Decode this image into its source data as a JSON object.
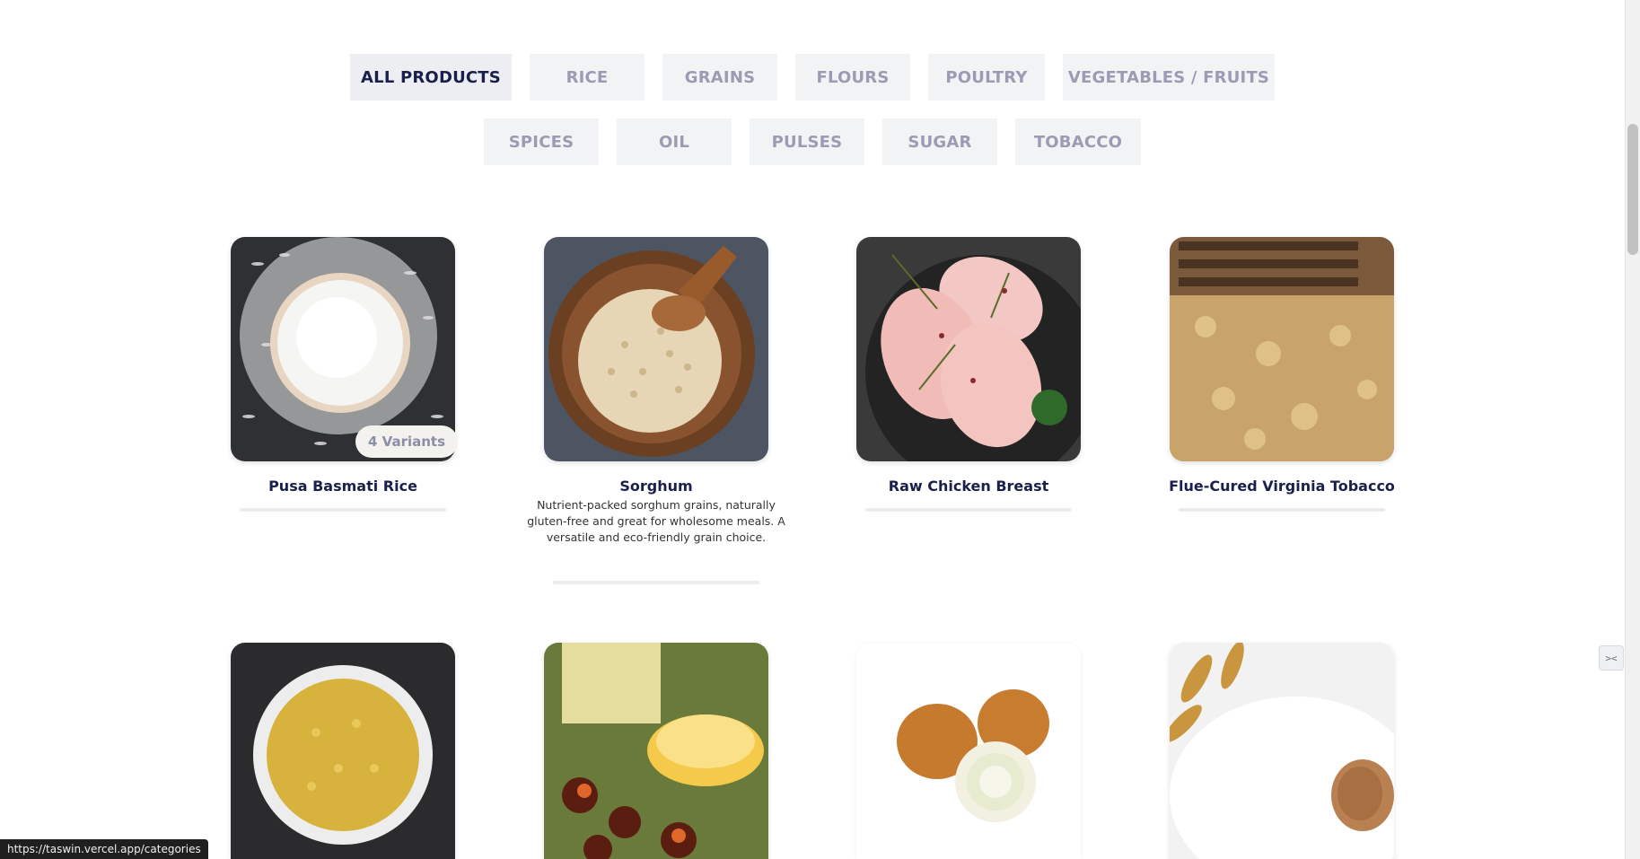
{
  "filters": {
    "row1": [
      "ALL PRODUCTS",
      "RICE",
      "GRAINS",
      "FLOURS",
      "POULTRY",
      "VEGETABLES / FRUITS"
    ],
    "row2": [
      "SPICES",
      "OIL",
      "PULSES",
      "SUGAR",
      "TOBACCO"
    ],
    "active": "ALL PRODUCTS"
  },
  "products": [
    {
      "name": "Pusa Basmati Rice",
      "badge": "4 Variants",
      "description": ""
    },
    {
      "name": "Sorghum",
      "badge": "",
      "description": "Nutrient-packed sorghum grains, naturally gluten-free and great for wholesome meals. A versatile and eco-friendly grain choice."
    },
    {
      "name": "Raw Chicken Breast",
      "badge": "",
      "description": ""
    },
    {
      "name": "Flue-Cured Virginia Tobacco",
      "badge": "",
      "description": ""
    }
  ],
  "status_bar": {
    "url": "https://taswin.vercel.app/categories"
  },
  "icons": {
    "widget": "chat-widget-icon"
  },
  "colors": {
    "active_tab_text": "#1a1f4b",
    "inactive_tab_text": "#9a9cb4",
    "tab_background": "#f2f3f5",
    "title_color": "#1a1f4b"
  }
}
